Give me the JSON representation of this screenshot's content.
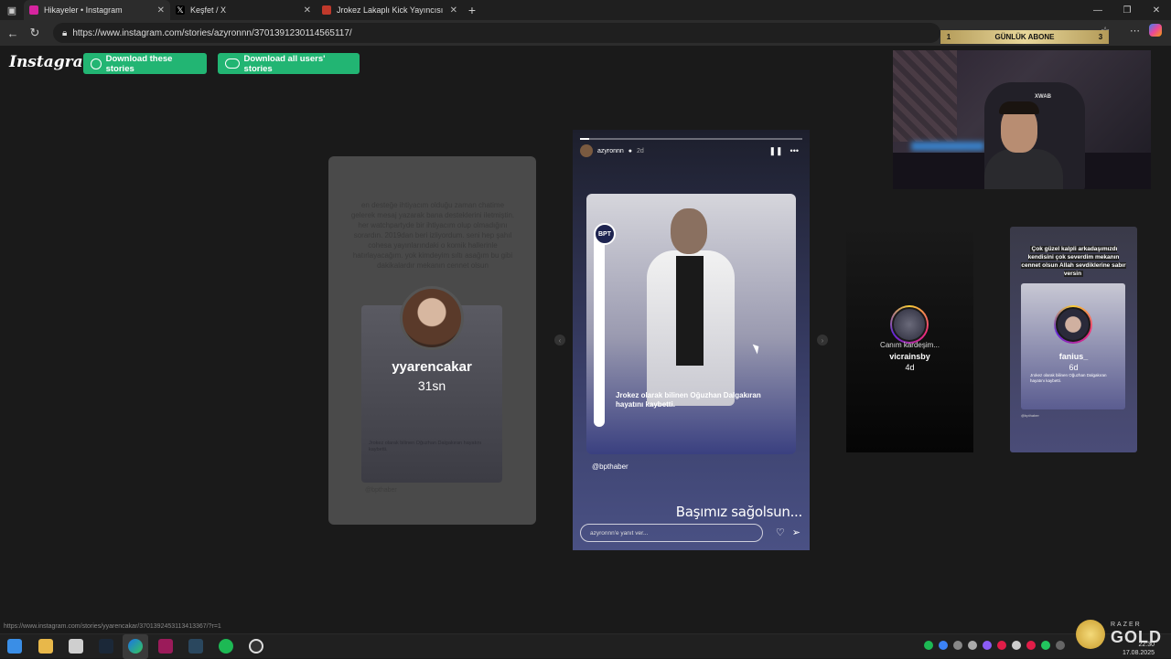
{
  "browser": {
    "tabs": [
      {
        "label": "Hikayeler • Instagram",
        "color": "#d6249f"
      },
      {
        "label": "Keşfet / X",
        "color": "#000000"
      },
      {
        "label": "Jrokez Lakaplı Kick Yayıncısı Oğuzhan",
        "color": "#c0392b"
      }
    ],
    "url": "https://www.instagram.com/stories/azyronnn/3701391230114565117/",
    "status_url": "https://www.instagram.com/stories/yyarencakar/3701392453113413367/?r=1"
  },
  "overlay": {
    "rank": "1",
    "label": "GÜNLÜK ABONE",
    "count": "3"
  },
  "instagram": {
    "logo": "Instagram",
    "download_stories": "Download these stories",
    "download_all": "Download all users' stories"
  },
  "left_story": {
    "username": "yyarencakar",
    "time": "31sn",
    "blurred_text": "en desteğe ihtiyacım olduğu zaman chatime gelerek mesaj yazarak bana desteklerini iletmiştin. her watchpartyde bir ihtiyacım olup olmadığını sorardın. 2019dan beri izliyordum. seni hep şahıl cohesa yayınlarındaki o komik hallerinle hatırlayacağım. yok kimdeyim sıltı asağım bu gibi dakikalardır mekanın cennet olsun",
    "inner_caption": "Jrokez olarak bilinen Oğuzhan Dalgakıran hayatını kaybetti.",
    "footer": "@bpthaber"
  },
  "main_story": {
    "username": "azyronnn",
    "ago": "2d",
    "progress": 0.04,
    "badge": "BPT",
    "caption": "Jrokez olarak bilinen Oğuzhan Dalgakıran hayatını kaybetti.",
    "handle": "@bpthaber",
    "big_caption": "Başımız sağolsun...",
    "reply_placeholder": "azyronnn'e yanıt ver..."
  },
  "right_story_1": {
    "subtitle": "Canım kardeşim...",
    "username": "vicrainsby",
    "time": "4d"
  },
  "right_story_2": {
    "note": "Çok güzel kalpli arkadaşımızdı kendisini çok severdim mekanın cennet olsun Allah sevdiklerine sabır versin",
    "username": "fanius_",
    "time": "6d",
    "mini_caption": "Jrokez olarak bilinen Oğuzhan Dalgakıran hayatını kaybetti.",
    "mini_handle": "@bpthaber"
  },
  "webcam": {
    "chair_logo": "XWAB"
  },
  "razer": {
    "brand": "RAZER",
    "product": "GOLD"
  },
  "clock": {
    "time": "22:30",
    "date": "17.08.2025"
  }
}
